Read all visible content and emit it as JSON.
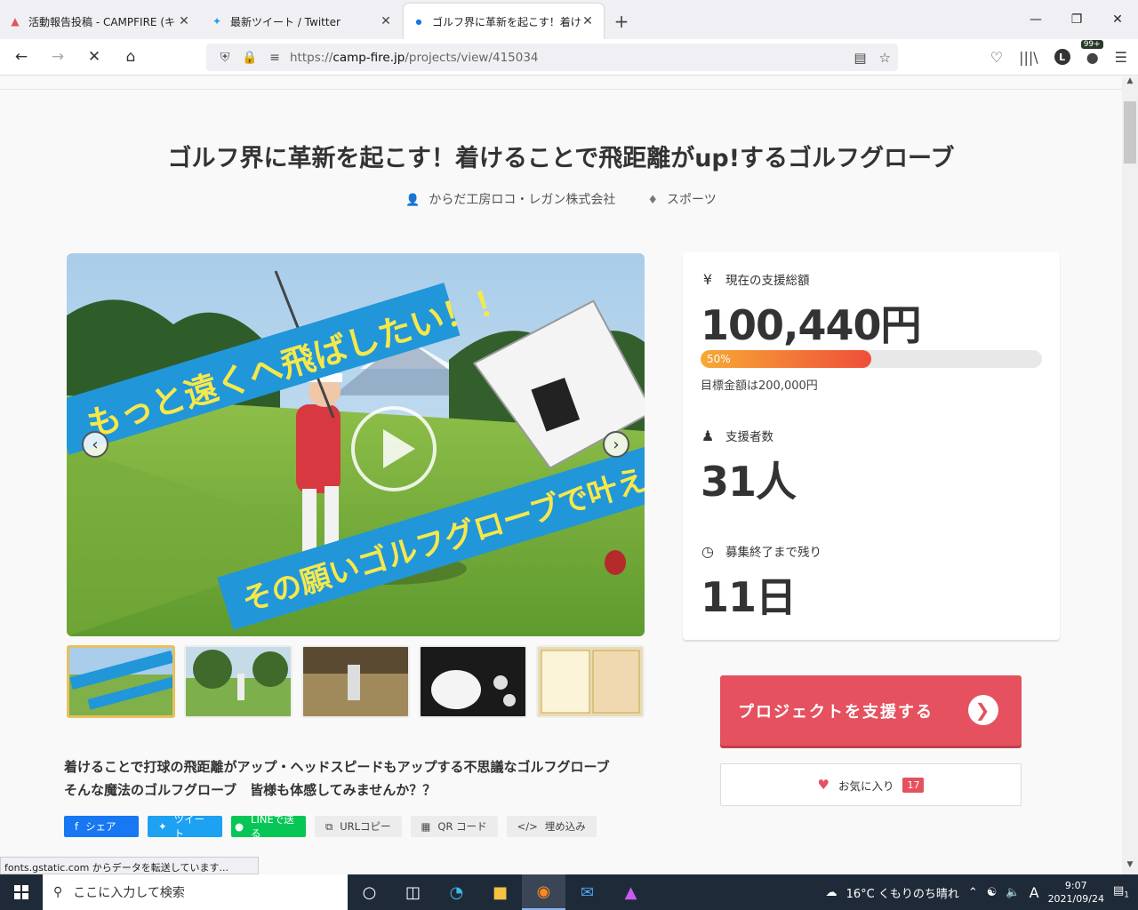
{
  "browser": {
    "tabs": [
      {
        "title": "活動報告投稿 - CAMPFIRE (キャ",
        "icon": "campfire-icon",
        "active": false
      },
      {
        "title": "最新ツイート / Twitter",
        "icon": "twitter-icon",
        "active": false
      },
      {
        "title": "ゴルフ界に革新を起こす！着けること",
        "icon": "campfire-dot-icon",
        "active": true
      }
    ],
    "url_prefix": "https://",
    "url_domain": "camp-fire.jp",
    "url_path": "/projects/view/415034",
    "badge_count": "99+",
    "profile_letter": "L"
  },
  "project": {
    "title": "ゴルフ界に革新を起こす！着けることで飛距離がup!するゴルフグローブ",
    "owner": "からだ工房ロコ・レガン株式会社",
    "category": "スポーツ",
    "hero_text_top": "もっと遠くへ飛ばしたい！！",
    "hero_text_bottom": "その願いゴルフグローブで叶えました★",
    "description_line1": "着けることで打球の飛距離がアップ・ヘッドスピードもアップする不思議なゴルフグローブ",
    "description_line2": "そんな魔法のゴルフグローブ　皆様も体感してみませんか？？"
  },
  "share": {
    "facebook": "シェア",
    "twitter": "ツイート",
    "line": "LINEで送る",
    "url_copy": "URLコピー",
    "qr": "QR コード",
    "embed": "埋め込み"
  },
  "stats": {
    "total_label": "現在の支援総額",
    "total_value": "100,440円",
    "progress_pct": 50,
    "progress_text": "50%",
    "goal_text": "目標金額は200,000円",
    "backers_label": "支援者数",
    "backers_value": "31人",
    "remaining_label": "募集終了まで残り",
    "remaining_value": "11日"
  },
  "actions": {
    "support_label": "プロジェクトを支援する",
    "favorite_label": "お気に入り",
    "favorite_count": "17"
  },
  "status_text": "fonts.gstatic.com からデータを転送しています...",
  "taskbar": {
    "search_placeholder": "ここに入力して検索",
    "weather": "16°C くもりのち晴れ",
    "time": "9:07",
    "date": "2021/09/24",
    "ime": "A",
    "notification_count": "1"
  },
  "colors": {
    "accent": "#e5515f",
    "progress_start": "#f7a934",
    "progress_end": "#ef4e3a",
    "hero_banner": "#2196d9"
  }
}
